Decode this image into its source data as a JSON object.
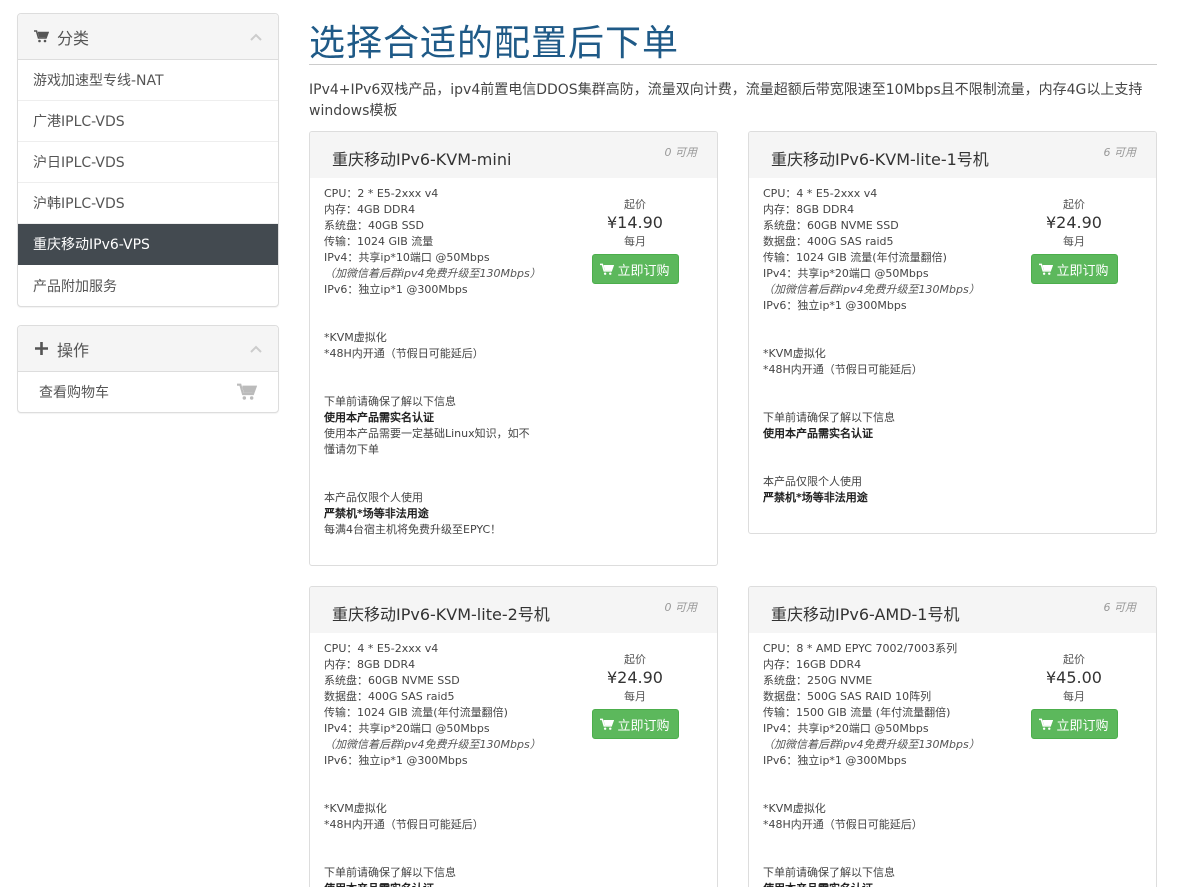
{
  "sidebar": {
    "categories_title": "分类",
    "items": [
      {
        "label": "游戏加速型专线-NAT",
        "active": false
      },
      {
        "label": "广港IPLC-VDS",
        "active": false
      },
      {
        "label": "沪日IPLC-VDS",
        "active": false
      },
      {
        "label": "沪韩IPLC-VDS",
        "active": false
      },
      {
        "label": "重庆移动IPv6-VPS",
        "active": true
      },
      {
        "label": "产品附加服务",
        "active": false
      }
    ],
    "actions_title": "操作",
    "view_cart_label": "查看购物车"
  },
  "header": {
    "title": "选择合适的配置后下单",
    "intro": "IPv4+IPv6双栈产品，ipv4前置电信DDOS集群高防，流量双向计费，流量超额后带宽限速至10Mbps且不限制流量，内存4G以上支持windows模板"
  },
  "colors": {
    "accent_title": "#1f5a87",
    "active_nav": "#434a50",
    "order_button": "#5cb85c"
  },
  "products": [
    {
      "name": "重庆移动IPv6-KVM-mini",
      "qty": "0 可用",
      "price_from": "起价",
      "price": "¥14.90",
      "cycle": "每月",
      "order_label": "立即订购",
      "lines": [
        {
          "t": "CPU：2 * E5-2xxx v4",
          "s": "n"
        },
        {
          "t": "内存：4GB DDR4",
          "s": "n"
        },
        {
          "t": "系统盘：40GB SSD",
          "s": "n"
        },
        {
          "t": "传输：1024 GIB 流量",
          "s": "n"
        },
        {
          "t": "IPv4：共享ip*10端口 @50Mbps",
          "s": "n"
        },
        {
          "t": "（加微信着后群ipv4免费升级至130Mbps）",
          "s": "i"
        },
        {
          "t": "IPv6：独立ip*1 @300Mbps",
          "s": "n"
        },
        {
          "t": "",
          "s": "gap"
        },
        {
          "t": "*KVM虚拟化",
          "s": "n"
        },
        {
          "t": "*48H内开通（节假日可能延后）",
          "s": "n"
        },
        {
          "t": "",
          "s": "gap"
        },
        {
          "t": "下单前请确保了解以下信息",
          "s": "n"
        },
        {
          "t": "使用本产品需实名认证",
          "s": "b"
        },
        {
          "t": "使用本产品需要一定基础Linux知识，如不",
          "s": "n"
        },
        {
          "t": "懂请勿下单",
          "s": "n"
        },
        {
          "t": "",
          "s": "gap"
        },
        {
          "t": "本产品仅限个人使用",
          "s": "n"
        },
        {
          "t": "严禁机*场等非法用途",
          "s": "b"
        },
        {
          "t": "每满4台宿主机将免费升级至EPYC！",
          "s": "n"
        }
      ]
    },
    {
      "name": "重庆移动IPv6-KVM-lite-1号机",
      "qty": "6 可用",
      "price_from": "起价",
      "price": "¥24.90",
      "cycle": "每月",
      "order_label": "立即订购",
      "lines": [
        {
          "t": "CPU：4 * E5-2xxx v4",
          "s": "n"
        },
        {
          "t": "内存：8GB DDR4",
          "s": "n"
        },
        {
          "t": "系统盘：60GB NVME SSD",
          "s": "n"
        },
        {
          "t": "数据盘：400G SAS raid5",
          "s": "n"
        },
        {
          "t": "传输：1024 GIB 流量(年付流量翻倍)",
          "s": "n"
        },
        {
          "t": "IPv4：共享ip*20端口 @50Mbps",
          "s": "n"
        },
        {
          "t": "（加微信着后群ipv4免费升级至130Mbps）",
          "s": "i"
        },
        {
          "t": "IPv6：独立ip*1 @300Mbps",
          "s": "n"
        },
        {
          "t": "",
          "s": "gap"
        },
        {
          "t": "*KVM虚拟化",
          "s": "n"
        },
        {
          "t": "*48H内开通（节假日可能延后）",
          "s": "n"
        },
        {
          "t": "",
          "s": "gap"
        },
        {
          "t": "下单前请确保了解以下信息",
          "s": "n"
        },
        {
          "t": "使用本产品需实名认证",
          "s": "b"
        },
        {
          "t": "",
          "s": "gap"
        },
        {
          "t": "本产品仅限个人使用",
          "s": "n"
        },
        {
          "t": "严禁机*场等非法用途",
          "s": "b"
        }
      ]
    },
    {
      "name": "重庆移动IPv6-KVM-lite-2号机",
      "qty": "0 可用",
      "price_from": "起价",
      "price": "¥24.90",
      "cycle": "每月",
      "order_label": "立即订购",
      "lines": [
        {
          "t": "CPU：4 * E5-2xxx v4",
          "s": "n"
        },
        {
          "t": "内存：8GB DDR4",
          "s": "n"
        },
        {
          "t": "系统盘：60GB NVME SSD",
          "s": "n"
        },
        {
          "t": "数据盘：400G SAS raid5",
          "s": "n"
        },
        {
          "t": "传输：1024 GIB 流量(年付流量翻倍)",
          "s": "n"
        },
        {
          "t": "IPv4：共享ip*20端口 @50Mbps",
          "s": "n"
        },
        {
          "t": "（加微信着后群ipv4免费升级至130Mbps）",
          "s": "i"
        },
        {
          "t": "IPv6：独立ip*1 @300Mbps",
          "s": "n"
        },
        {
          "t": "",
          "s": "gap"
        },
        {
          "t": "*KVM虚拟化",
          "s": "n"
        },
        {
          "t": "*48H内开通（节假日可能延后）",
          "s": "n"
        },
        {
          "t": "",
          "s": "gap"
        },
        {
          "t": "下单前请确保了解以下信息",
          "s": "n"
        },
        {
          "t": "使用本产品需实名认证",
          "s": "b"
        }
      ]
    },
    {
      "name": "重庆移动IPv6-AMD-1号机",
      "qty": "6 可用",
      "price_from": "起价",
      "price": "¥45.00",
      "cycle": "每月",
      "order_label": "立即订购",
      "lines": [
        {
          "t": "CPU：8 * AMD EPYC 7002/7003系列",
          "s": "n"
        },
        {
          "t": "内存：16GB DDR4",
          "s": "n"
        },
        {
          "t": "系统盘：250G NVME",
          "s": "n"
        },
        {
          "t": "数据盘：500G SAS RAID 10阵列",
          "s": "n"
        },
        {
          "t": "传输：1500 GIB 流量 (年付流量翻倍)",
          "s": "n"
        },
        {
          "t": "IPv4：共享ip*20端口 @50Mbps",
          "s": "n"
        },
        {
          "t": "（加微信着后群ipv4免费升级至130Mbps）",
          "s": "i"
        },
        {
          "t": "IPv6：独立ip*1 @300Mbps",
          "s": "n"
        },
        {
          "t": "",
          "s": "gap"
        },
        {
          "t": "*KVM虚拟化",
          "s": "n"
        },
        {
          "t": "*48H内开通（节假日可能延后）",
          "s": "n"
        },
        {
          "t": "",
          "s": "gap"
        },
        {
          "t": "下单前请确保了解以下信息",
          "s": "n"
        },
        {
          "t": "使用本产品需实名认证",
          "s": "b"
        }
      ]
    }
  ]
}
